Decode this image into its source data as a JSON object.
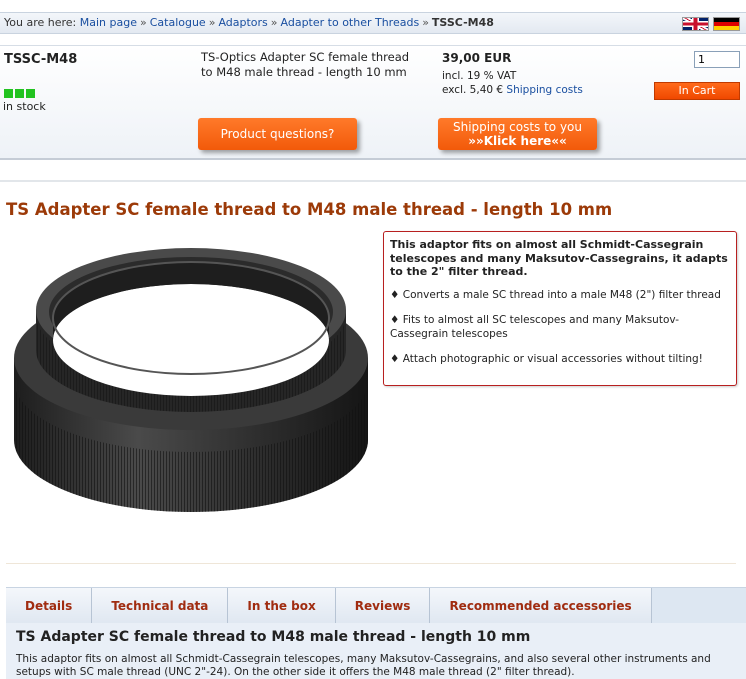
{
  "breadcrumb": {
    "prefix": "You are here:",
    "items": [
      "Main page",
      "Catalogue",
      "Adaptors",
      "Adapter to other Threads"
    ],
    "separator": "»",
    "current": "TSSC-M48"
  },
  "product": {
    "sku": "TSSC-M48",
    "stock_text": "in stock",
    "short_name": "TS-Optics Adapter SC female thread to M48 male thread - length 10 mm",
    "price": "39,00 EUR",
    "vat": "incl. 19 % VAT",
    "shipping_prefix": "excl. 5,40 €",
    "shipping_link": "Shipping costs",
    "quantity": "1",
    "cart_button": "In Cart",
    "questions_button": "Product questions?",
    "shipping_button_line1": "Shipping costs to you",
    "shipping_button_line2": "»»Klick here««"
  },
  "main": {
    "title": "TS Adapter SC female thread to M48 male thread - length 10 mm",
    "description": {
      "intro": "This adaptor fits on almost all Schmidt-Cassegrain telescopes and many Maksutov-Cassegrains, it adapts to the 2\" filter thread.",
      "bullets": [
        "♦ Converts a male SC thread into a male M48 (2\") filter thread",
        "♦ Fits to almost all SC telescopes and many Maksutov-Cassegrain telescopes",
        "♦ Attach photographic or visual accessories without tilting!"
      ]
    },
    "tabs": [
      "Details",
      "Technical data",
      "In the box",
      "Reviews",
      "Recommended accessories"
    ],
    "panel": {
      "title": "TS Adapter SC female thread to M48 male thread - length 10 mm",
      "text": "This adaptor fits on almost all Schmidt-Cassegrain telescopes, many Maksutov-Cassegrains, and also several other instruments and setups with SC male thread (UNC 2\"-24). On the other side it offers the M48 male thread (2\" filter thread)."
    }
  },
  "colors": {
    "accent_orange": "#f25a0a",
    "title_brown": "#9c3a08",
    "stock_green": "#22c320",
    "link_blue": "#1a4fa0"
  },
  "icons": [
    "uk-flag-icon",
    "german-flag-icon"
  ]
}
